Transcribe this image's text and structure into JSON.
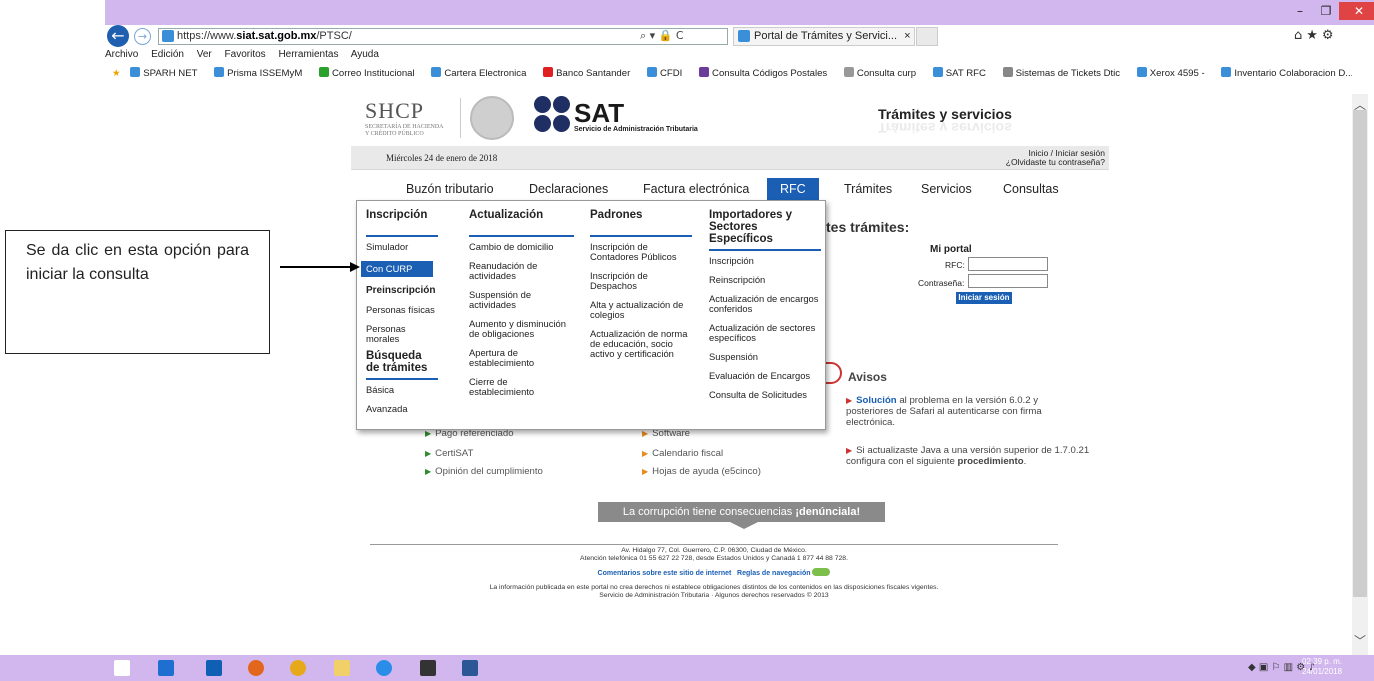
{
  "browser": {
    "url_prefix": "https://www.",
    "url_host": "siat.sat.gob.mx",
    "url_path": "/PTSC/",
    "addr_tools": "⌕ ▾ 🔒 C",
    "tab_title": "Portal de Trámites y Servici...",
    "tab_close": "×",
    "menu": [
      "Archivo",
      "Edición",
      "Ver",
      "Favoritos",
      "Herramientas",
      "Ayuda"
    ],
    "favorites": [
      "SPARH NET",
      "Prisma ISSEMyM",
      "Correo Institucional",
      "Cartera Electronica",
      "Banco Santander",
      "CFDI",
      "Consulta Códigos Postales",
      "Consulta curp",
      "SAT RFC",
      "Sistemas de Tickets Dtic",
      "Xerox 4595 -",
      "Inventario Colaboracion D..."
    ],
    "right_icons": "⌂★⚙"
  },
  "header": {
    "shcp": "SHCP",
    "shcp_sub1": "SECRETARÍA DE HACIENDA",
    "shcp_sub2": "Y CRÉDITO PÚBLICO",
    "sat": "SAT",
    "sat_sub": "Servicio de Administración Tributaria",
    "title": "Trámites y servicios"
  },
  "datebar": {
    "date": "Miércoles 24 de enero de 2018",
    "login": "Inicio / Iniciar sesión",
    "forgot": "¿Olvidaste tu contraseña?"
  },
  "nav": [
    "Buzón tributario",
    "Declaraciones",
    "Factura electrónica",
    "RFC",
    "Trámites",
    "Servicios",
    "Consultas"
  ],
  "dropdown": {
    "col1": {
      "head": "Inscripción",
      "items": [
        "Simulador",
        "Con CURP",
        "Preinscripción",
        "Personas físicas",
        "Personas morales"
      ],
      "head2": "Búsqueda de trámites",
      "items2": [
        "Básica",
        "Avanzada"
      ]
    },
    "col2": {
      "head": "Actualización",
      "items": [
        "Cambio de domicilio",
        "Reanudación de actividades",
        "Suspensión de actividades",
        "Aumento y disminución de obligaciones",
        "Apertura de establecimiento",
        "Cierre de establecimiento"
      ]
    },
    "col3": {
      "head": "Padrones",
      "items": [
        "Inscripción de Contadores Públicos",
        "Inscripción de Despachos",
        "Alta y actualización de colegios",
        "Actualización de norma de educación, socio activo y certificación"
      ]
    },
    "col4": {
      "head": "Importadores y Sectores Específicos",
      "items": [
        "Inscripción",
        "Reinscripción",
        "Actualización de encargos conferidos",
        "Actualización de sectores específicos",
        "Suspensión",
        "Evaluación de Encargos",
        "Consulta de Solicitudes"
      ]
    }
  },
  "callout": {
    "text": "Se da clic en esta opción para iniciar la consulta"
  },
  "portal": {
    "tramites_title": "tes trámites:",
    "mi_portal": "Mi portal",
    "rfc_label": "RFC:",
    "pw_label": "Contraseña:",
    "login_button": "Iniciar sesión"
  },
  "avisos": {
    "title": "Avisos",
    "a1_bold": "Solución",
    "a1_rest": "al problema en la versión 6.0.2 y posteriores de Safari al autenticarse con firma electrónica.",
    "a2_text": "Si actualizaste Java a una versión superior de 1.7.0.21 configura con el siguiente",
    "a2_bold": "procedimiento",
    "a2_end": "."
  },
  "links": {
    "left": [
      "Pago referenciado",
      "CertiSAT",
      "Opinión del cumplimiento"
    ],
    "mid": [
      "Software",
      "Calendario fiscal",
      "Hojas de ayuda (e5cinco)"
    ]
  },
  "banner": {
    "text": "La corrupción tiene consecuencias",
    "bold": "¡denúnciala!"
  },
  "footer": {
    "l1": "Av. Hidalgo 77, Col. Guerrero, C.P. 06300, Ciudad de México.",
    "l2": "Atención telefónica 01 55 627 22 728, desde Estados Unidos y Canadá 1 877 44 88 728.",
    "link1": "Comentarios sobre este sitio de internet",
    "link2": "Reglas de navegación",
    "l3": "La información publicada en este portal no crea derechos ni establece obligaciones distintos de los contenidos en las disposiciones fiscales vigentes.",
    "l4": "Servicio de Administración Tributaria · Algunos derechos reservados © 2013"
  },
  "taskbar": {
    "time": "02:39 p. m.",
    "date": "24/01/2018"
  }
}
